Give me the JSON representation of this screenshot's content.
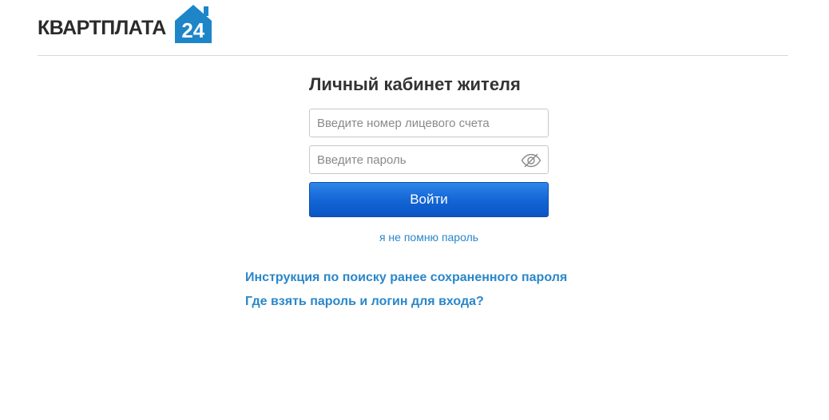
{
  "brand": {
    "name": "КВАРТПЛАТА",
    "number": "24",
    "accent_color": "#1d85c8"
  },
  "login": {
    "title": "Личный кабинет жителя",
    "account_placeholder": "Введите номер лицевого счета",
    "account_value": "",
    "password_placeholder": "Введите пароль",
    "password_value": "",
    "password_toggle_icon": "eye-slash-icon",
    "submit_label": "Войти",
    "forgot_label": "я не помню пароль",
    "button_color": "#1466d6"
  },
  "help": {
    "links": [
      "Инструкция по поиску ранее сохраненного пароля",
      "Где взять пароль и логин для входа?"
    ],
    "link_color": "#2a87c9"
  }
}
